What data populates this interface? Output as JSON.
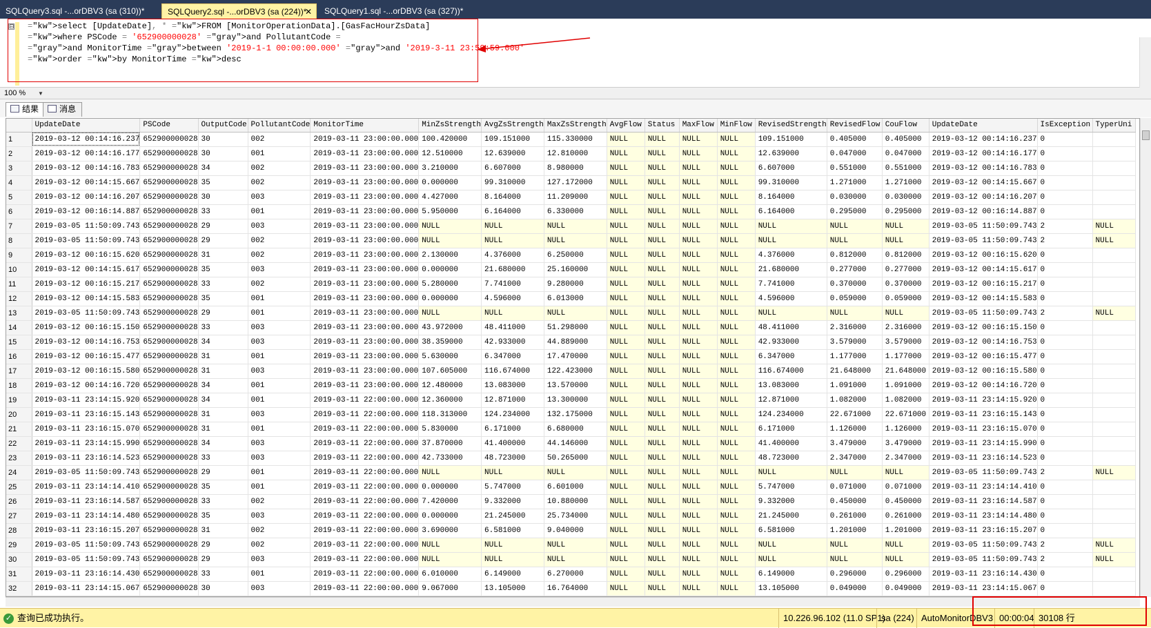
{
  "tabs": [
    {
      "label": "SQLQuery3.sql -...orDBV3 (sa (310))*",
      "active": false
    },
    {
      "label": "SQLQuery2.sql -...orDBV3 (sa (224))*",
      "active": true
    },
    {
      "label": "SQLQuery1.sql -...orDBV3 (sa (327))*",
      "active": false
    }
  ],
  "editor": {
    "collapse_glyph": "⊟",
    "lines": [
      "select [UpdateDate], * FROM [MonitorOperationData].[GasFacHourZsData]",
      "where PSCode = '652900000028' and PollutantCode =",
      "and MonitorTime between '2019-1-1 00:00:00.000' and '2019-3-11 23:59:59.000'",
      "order by MonitorTime desc"
    ]
  },
  "zoom": "100 %",
  "result_tabs": {
    "results": "结果",
    "messages": "消息"
  },
  "columns": [
    "",
    "UpdateDate",
    "PSCode",
    "OutputCode",
    "PollutantCode",
    "MonitorTime",
    "MinZsStrength",
    "AvgZsStrength",
    "MaxZsStrength",
    "AvgFlow",
    "Status",
    "MaxFlow",
    "MinFlow",
    "RevisedStrength",
    "RevisedFlow",
    "CouFlow",
    "UpdateDate",
    "IsException",
    "TyperUni"
  ],
  "rows": [
    [
      "1",
      "2019-03-12 00:14:16.237",
      "652900000028",
      "30",
      "002",
      "2019-03-11 23:00:00.000",
      "100.420000",
      "109.151000",
      "115.330000",
      "NULL",
      "NULL",
      "NULL",
      "NULL",
      "109.151000",
      "0.405000",
      "0.405000",
      "2019-03-12 00:14:16.237",
      "0",
      ""
    ],
    [
      "2",
      "2019-03-12 00:14:16.177",
      "652900000028",
      "30",
      "001",
      "2019-03-11 23:00:00.000",
      "12.510000",
      "12.639000",
      "12.810000",
      "NULL",
      "NULL",
      "NULL",
      "NULL",
      "12.639000",
      "0.047000",
      "0.047000",
      "2019-03-12 00:14:16.177",
      "0",
      ""
    ],
    [
      "3",
      "2019-03-12 00:14:16.783",
      "652900000028",
      "34",
      "002",
      "2019-03-11 23:00:00.000",
      "3.210000",
      "6.607000",
      "8.980000",
      "NULL",
      "NULL",
      "NULL",
      "NULL",
      "6.607000",
      "0.551000",
      "0.551000",
      "2019-03-12 00:14:16.783",
      "0",
      ""
    ],
    [
      "4",
      "2019-03-12 00:14:15.667",
      "652900000028",
      "35",
      "002",
      "2019-03-11 23:00:00.000",
      "0.000000",
      "99.310000",
      "127.172000",
      "NULL",
      "NULL",
      "NULL",
      "NULL",
      "99.310000",
      "1.271000",
      "1.271000",
      "2019-03-12 00:14:15.667",
      "0",
      ""
    ],
    [
      "5",
      "2019-03-12 00:14:16.207",
      "652900000028",
      "30",
      "003",
      "2019-03-11 23:00:00.000",
      "4.427000",
      "8.164000",
      "11.209000",
      "NULL",
      "NULL",
      "NULL",
      "NULL",
      "8.164000",
      "0.030000",
      "0.030000",
      "2019-03-12 00:14:16.207",
      "0",
      ""
    ],
    [
      "6",
      "2019-03-12 00:16:14.887",
      "652900000028",
      "33",
      "001",
      "2019-03-11 23:00:00.000",
      "5.950000",
      "6.164000",
      "6.330000",
      "NULL",
      "NULL",
      "NULL",
      "NULL",
      "6.164000",
      "0.295000",
      "0.295000",
      "2019-03-12 00:16:14.887",
      "0",
      ""
    ],
    [
      "7",
      "2019-03-05 11:50:09.743",
      "652900000028",
      "29",
      "003",
      "2019-03-11 23:00:00.000",
      "NULL",
      "NULL",
      "NULL",
      "NULL",
      "NULL",
      "NULL",
      "NULL",
      "NULL",
      "NULL",
      "NULL",
      "2019-03-05 11:50:09.743",
      "2",
      "NULL"
    ],
    [
      "8",
      "2019-03-05 11:50:09.743",
      "652900000028",
      "29",
      "002",
      "2019-03-11 23:00:00.000",
      "NULL",
      "NULL",
      "NULL",
      "NULL",
      "NULL",
      "NULL",
      "NULL",
      "NULL",
      "NULL",
      "NULL",
      "2019-03-05 11:50:09.743",
      "2",
      "NULL"
    ],
    [
      "9",
      "2019-03-12 00:16:15.620",
      "652900000028",
      "31",
      "002",
      "2019-03-11 23:00:00.000",
      "2.130000",
      "4.376000",
      "6.250000",
      "NULL",
      "NULL",
      "NULL",
      "NULL",
      "4.376000",
      "0.812000",
      "0.812000",
      "2019-03-12 00:16:15.620",
      "0",
      ""
    ],
    [
      "10",
      "2019-03-12 00:14:15.617",
      "652900000028",
      "35",
      "003",
      "2019-03-11 23:00:00.000",
      "0.000000",
      "21.680000",
      "25.160000",
      "NULL",
      "NULL",
      "NULL",
      "NULL",
      "21.680000",
      "0.277000",
      "0.277000",
      "2019-03-12 00:14:15.617",
      "0",
      ""
    ],
    [
      "11",
      "2019-03-12 00:16:15.217",
      "652900000028",
      "33",
      "002",
      "2019-03-11 23:00:00.000",
      "5.280000",
      "7.741000",
      "9.280000",
      "NULL",
      "NULL",
      "NULL",
      "NULL",
      "7.741000",
      "0.370000",
      "0.370000",
      "2019-03-12 00:16:15.217",
      "0",
      ""
    ],
    [
      "12",
      "2019-03-12 00:14:15.583",
      "652900000028",
      "35",
      "001",
      "2019-03-11 23:00:00.000",
      "0.000000",
      "4.596000",
      "6.013000",
      "NULL",
      "NULL",
      "NULL",
      "NULL",
      "4.596000",
      "0.059000",
      "0.059000",
      "2019-03-12 00:14:15.583",
      "0",
      ""
    ],
    [
      "13",
      "2019-03-05 11:50:09.743",
      "652900000028",
      "29",
      "001",
      "2019-03-11 23:00:00.000",
      "NULL",
      "NULL",
      "NULL",
      "NULL",
      "NULL",
      "NULL",
      "NULL",
      "NULL",
      "NULL",
      "NULL",
      "2019-03-05 11:50:09.743",
      "2",
      "NULL"
    ],
    [
      "14",
      "2019-03-12 00:16:15.150",
      "652900000028",
      "33",
      "003",
      "2019-03-11 23:00:00.000",
      "43.972000",
      "48.411000",
      "51.298000",
      "NULL",
      "NULL",
      "NULL",
      "NULL",
      "48.411000",
      "2.316000",
      "2.316000",
      "2019-03-12 00:16:15.150",
      "0",
      ""
    ],
    [
      "15",
      "2019-03-12 00:14:16.753",
      "652900000028",
      "34",
      "003",
      "2019-03-11 23:00:00.000",
      "38.359000",
      "42.933000",
      "44.889000",
      "NULL",
      "NULL",
      "NULL",
      "NULL",
      "42.933000",
      "3.579000",
      "3.579000",
      "2019-03-12 00:14:16.753",
      "0",
      ""
    ],
    [
      "16",
      "2019-03-12 00:16:15.477",
      "652900000028",
      "31",
      "001",
      "2019-03-11 23:00:00.000",
      "5.630000",
      "6.347000",
      "17.470000",
      "NULL",
      "NULL",
      "NULL",
      "NULL",
      "6.347000",
      "1.177000",
      "1.177000",
      "2019-03-12 00:16:15.477",
      "0",
      ""
    ],
    [
      "17",
      "2019-03-12 00:16:15.580",
      "652900000028",
      "31",
      "003",
      "2019-03-11 23:00:00.000",
      "107.605000",
      "116.674000",
      "122.423000",
      "NULL",
      "NULL",
      "NULL",
      "NULL",
      "116.674000",
      "21.648000",
      "21.648000",
      "2019-03-12 00:16:15.580",
      "0",
      ""
    ],
    [
      "18",
      "2019-03-12 00:14:16.720",
      "652900000028",
      "34",
      "001",
      "2019-03-11 23:00:00.000",
      "12.480000",
      "13.083000",
      "13.570000",
      "NULL",
      "NULL",
      "NULL",
      "NULL",
      "13.083000",
      "1.091000",
      "1.091000",
      "2019-03-12 00:14:16.720",
      "0",
      ""
    ],
    [
      "19",
      "2019-03-11 23:14:15.920",
      "652900000028",
      "34",
      "001",
      "2019-03-11 22:00:00.000",
      "12.360000",
      "12.871000",
      "13.300000",
      "NULL",
      "NULL",
      "NULL",
      "NULL",
      "12.871000",
      "1.082000",
      "1.082000",
      "2019-03-11 23:14:15.920",
      "0",
      ""
    ],
    [
      "20",
      "2019-03-11 23:16:15.143",
      "652900000028",
      "31",
      "003",
      "2019-03-11 22:00:00.000",
      "118.313000",
      "124.234000",
      "132.175000",
      "NULL",
      "NULL",
      "NULL",
      "NULL",
      "124.234000",
      "22.671000",
      "22.671000",
      "2019-03-11 23:16:15.143",
      "0",
      ""
    ],
    [
      "21",
      "2019-03-11 23:16:15.070",
      "652900000028",
      "31",
      "001",
      "2019-03-11 22:00:00.000",
      "5.830000",
      "6.171000",
      "6.680000",
      "NULL",
      "NULL",
      "NULL",
      "NULL",
      "6.171000",
      "1.126000",
      "1.126000",
      "2019-03-11 23:16:15.070",
      "0",
      ""
    ],
    [
      "22",
      "2019-03-11 23:14:15.990",
      "652900000028",
      "34",
      "003",
      "2019-03-11 22:00:00.000",
      "37.870000",
      "41.400000",
      "44.146000",
      "NULL",
      "NULL",
      "NULL",
      "NULL",
      "41.400000",
      "3.479000",
      "3.479000",
      "2019-03-11 23:14:15.990",
      "0",
      ""
    ],
    [
      "23",
      "2019-03-11 23:16:14.523",
      "652900000028",
      "33",
      "003",
      "2019-03-11 22:00:00.000",
      "42.733000",
      "48.723000",
      "50.265000",
      "NULL",
      "NULL",
      "NULL",
      "NULL",
      "48.723000",
      "2.347000",
      "2.347000",
      "2019-03-11 23:16:14.523",
      "0",
      ""
    ],
    [
      "24",
      "2019-03-05 11:50:09.743",
      "652900000028",
      "29",
      "001",
      "2019-03-11 22:00:00.000",
      "NULL",
      "NULL",
      "NULL",
      "NULL",
      "NULL",
      "NULL",
      "NULL",
      "NULL",
      "NULL",
      "NULL",
      "2019-03-05 11:50:09.743",
      "2",
      "NULL"
    ],
    [
      "25",
      "2019-03-11 23:14:14.410",
      "652900000028",
      "35",
      "001",
      "2019-03-11 22:00:00.000",
      "0.000000",
      "5.747000",
      "6.601000",
      "NULL",
      "NULL",
      "NULL",
      "NULL",
      "5.747000",
      "0.071000",
      "0.071000",
      "2019-03-11 23:14:14.410",
      "0",
      ""
    ],
    [
      "26",
      "2019-03-11 23:16:14.587",
      "652900000028",
      "33",
      "002",
      "2019-03-11 22:00:00.000",
      "7.420000",
      "9.332000",
      "10.880000",
      "NULL",
      "NULL",
      "NULL",
      "NULL",
      "9.332000",
      "0.450000",
      "0.450000",
      "2019-03-11 23:16:14.587",
      "0",
      ""
    ],
    [
      "27",
      "2019-03-11 23:14:14.480",
      "652900000028",
      "35",
      "003",
      "2019-03-11 22:00:00.000",
      "0.000000",
      "21.245000",
      "25.734000",
      "NULL",
      "NULL",
      "NULL",
      "NULL",
      "21.245000",
      "0.261000",
      "0.261000",
      "2019-03-11 23:14:14.480",
      "0",
      ""
    ],
    [
      "28",
      "2019-03-11 23:16:15.207",
      "652900000028",
      "31",
      "002",
      "2019-03-11 22:00:00.000",
      "3.690000",
      "6.581000",
      "9.040000",
      "NULL",
      "NULL",
      "NULL",
      "NULL",
      "6.581000",
      "1.201000",
      "1.201000",
      "2019-03-11 23:16:15.207",
      "0",
      ""
    ],
    [
      "29",
      "2019-03-05 11:50:09.743",
      "652900000028",
      "29",
      "002",
      "2019-03-11 22:00:00.000",
      "NULL",
      "NULL",
      "NULL",
      "NULL",
      "NULL",
      "NULL",
      "NULL",
      "NULL",
      "NULL",
      "NULL",
      "2019-03-05 11:50:09.743",
      "2",
      "NULL"
    ],
    [
      "30",
      "2019-03-05 11:50:09.743",
      "652900000028",
      "29",
      "003",
      "2019-03-11 22:00:00.000",
      "NULL",
      "NULL",
      "NULL",
      "NULL",
      "NULL",
      "NULL",
      "NULL",
      "NULL",
      "NULL",
      "NULL",
      "2019-03-05 11:50:09.743",
      "2",
      "NULL"
    ],
    [
      "31",
      "2019-03-11 23:16:14.430",
      "652900000028",
      "33",
      "001",
      "2019-03-11 22:00:00.000",
      "6.010000",
      "6.149000",
      "6.270000",
      "NULL",
      "NULL",
      "NULL",
      "NULL",
      "6.149000",
      "0.296000",
      "0.296000",
      "2019-03-11 23:16:14.430",
      "0",
      ""
    ],
    [
      "32",
      "2019-03-11 23:14:15.067",
      "652900000028",
      "30",
      "003",
      "2019-03-11 22:00:00.000",
      "9.067000",
      "13.105000",
      "16.764000",
      "NULL",
      "NULL",
      "NULL",
      "NULL",
      "13.105000",
      "0.049000",
      "0.049000",
      "2019-03-11 23:14:15.067",
      "0",
      ""
    ]
  ],
  "status": {
    "message": "查询已成功执行。",
    "server": "10.226.96.102 (11.0 SP1)",
    "user": "sa (224)",
    "database": "AutoMonitorDBV3",
    "elapsed": "00:00:04",
    "rows": "30108 行"
  },
  "colors": {
    "annotation": "#e00000",
    "null_cell": "#ffffe1",
    "status_bar": "#fff3a5",
    "tab_bar": "#2b3c59"
  }
}
